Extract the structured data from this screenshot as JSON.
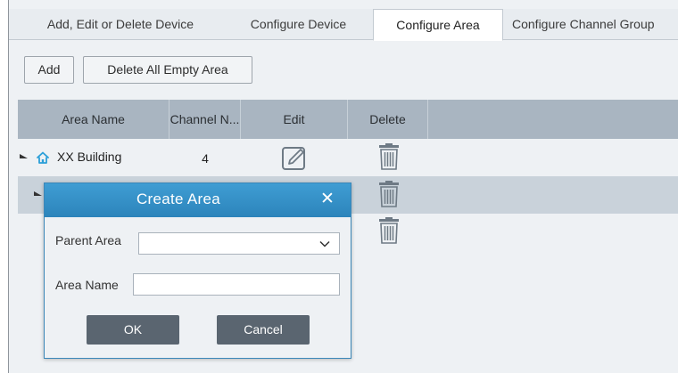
{
  "tabs": [
    {
      "label": "Add, Edit or Delete Device",
      "active": false
    },
    {
      "label": "Configure Device",
      "active": false
    },
    {
      "label": "Configure Area",
      "active": true
    },
    {
      "label": "Configure Channel Group",
      "active": false
    }
  ],
  "toolbar": {
    "add_label": "Add",
    "delete_empty_label": "Delete All Empty Area"
  },
  "grid": {
    "columns": [
      "Area Name",
      "Channel N...",
      "Edit",
      "Delete"
    ],
    "rows": [
      {
        "name": "XX Building",
        "channels": "4",
        "icon": "home-icon",
        "expanded": true
      },
      {
        "name": "",
        "channels": "",
        "selected": true
      },
      {
        "name": "",
        "channels": ""
      }
    ]
  },
  "dialog": {
    "title": "Create Area",
    "close_icon": "close-icon",
    "parent_area_label": "Parent Area",
    "parent_area_value": "",
    "area_name_label": "Area Name",
    "area_name_value": "",
    "ok_label": "OK",
    "cancel_label": "Cancel"
  },
  "colors": {
    "accent": "#2c84bb",
    "header": "#a9b5c1",
    "selected_row": "#c9d2da",
    "dialog_button": "#5a6570"
  }
}
